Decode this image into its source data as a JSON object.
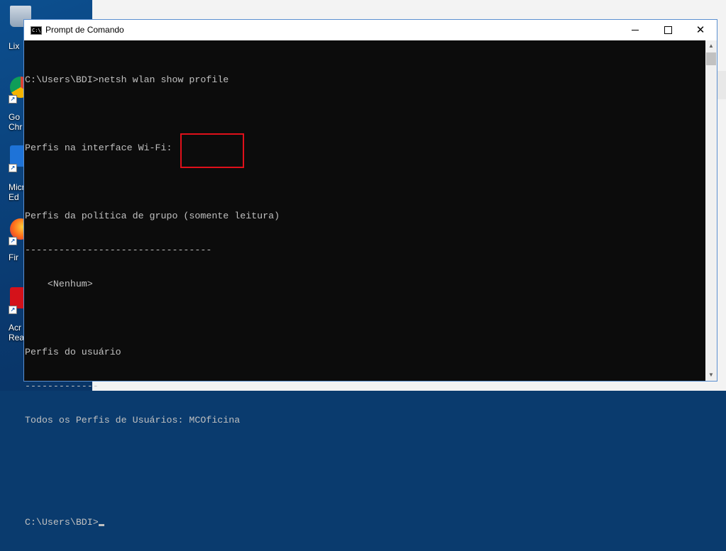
{
  "desktop": {
    "icons": [
      {
        "label": "Lix",
        "icon": "recycle-bin-icon"
      },
      {
        "label": "Go\nChr",
        "icon": "chrome-icon"
      },
      {
        "label": "Micr\nEd",
        "icon": "edge-icon"
      },
      {
        "label": "Fir",
        "icon": "firefox-icon"
      },
      {
        "label": "Acr\nRead",
        "icon": "acrobat-icon"
      }
    ]
  },
  "window": {
    "title": "Prompt de Comando",
    "icon": "cmd-icon",
    "controls": {
      "minimize": "minimize-icon",
      "maximize": "maximize-icon",
      "close": "close-icon"
    }
  },
  "console": {
    "lines": [
      "C:\\Users\\BDI>netsh wlan show profile",
      "",
      "Perfis na interface Wi-Fi:",
      "",
      "Perfis da política de grupo (somente leitura)",
      "---------------------------------",
      "    <Nenhum>",
      "",
      "Perfis do usuário",
      "-------------",
      "Todos os Perfis de Usuários: MCOficina",
      "",
      ""
    ],
    "prompt": "C:\\Users\\BDI>",
    "highlighted_profile": "MCOficina"
  },
  "colors": {
    "console_bg": "#0c0c0c",
    "console_fg": "#c0c0c0",
    "highlight_border": "#e0101a"
  }
}
